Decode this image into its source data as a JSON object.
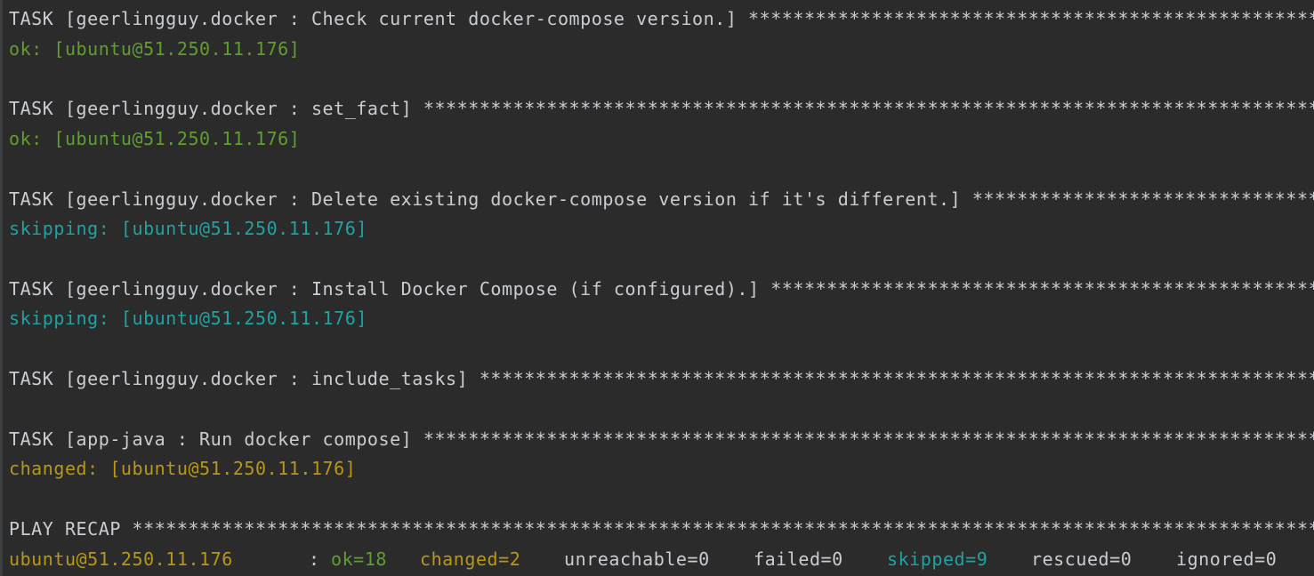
{
  "stars": "**************************************************************************************************************************************************************",
  "tasks": [
    {
      "header": "TASK [geerlingguy.docker : Check current docker-compose version.] ",
      "result": "ok: [ubuntu@51.250.11.176]"
    },
    {
      "header": "TASK [geerlingguy.docker : set_fact] ",
      "result": "ok: [ubuntu@51.250.11.176]"
    },
    {
      "header": "TASK [geerlingguy.docker : Delete existing docker-compose version if it's different.] ",
      "result": "skipping: [ubuntu@51.250.11.176]"
    },
    {
      "header": "TASK [geerlingguy.docker : Install Docker Compose (if configured).] ",
      "result": "skipping: [ubuntu@51.250.11.176]"
    },
    {
      "header": "TASK [geerlingguy.docker : include_tasks] "
    },
    {
      "header": "TASK [app-java : Run docker compose] ",
      "result": "changed: [ubuntu@51.250.11.176]"
    }
  ],
  "recap": {
    "header": "PLAY RECAP ",
    "host": "ubuntu@51.250.11.176",
    "colon": ":",
    "ok": "ok=18",
    "changed": "changed=2",
    "unreachable": "unreachable=0",
    "failed": "failed=0",
    "skipped": "skipped=9",
    "rescued": "rescued=0",
    "ignored": "ignored=0"
  },
  "colors": {
    "background": "#2b2b2b",
    "text": "#c9cdd2",
    "ok": "#5f9e2f",
    "skipping": "#21a2a2",
    "changed": "#b89717"
  }
}
